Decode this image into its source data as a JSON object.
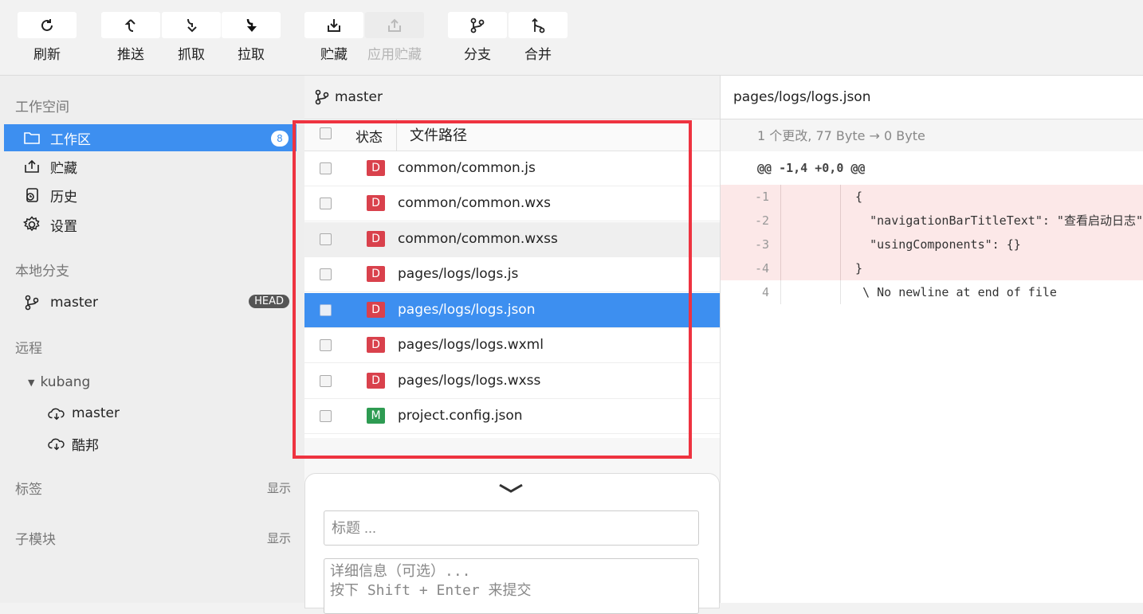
{
  "toolbar": {
    "refresh": "刷新",
    "push": "推送",
    "fetch": "抓取",
    "pull": "拉取",
    "stash": "贮藏",
    "apply_stash": "应用贮藏",
    "branch": "分支",
    "merge": "合并"
  },
  "sidebar": {
    "workspace_title": "工作空间",
    "items": [
      {
        "label": "工作区",
        "badge": "8",
        "icon": "folder-icon"
      },
      {
        "label": "贮藏",
        "icon": "stash-icon"
      },
      {
        "label": "历史",
        "icon": "history-icon"
      },
      {
        "label": "设置",
        "icon": "gear-icon"
      }
    ],
    "local_branches_title": "本地分支",
    "local_branch": {
      "label": "master",
      "badge": "HEAD"
    },
    "remote_title": "远程",
    "remote_name": "kubang",
    "remote_branches": [
      "master",
      "酷邦"
    ],
    "tags_title": "标签",
    "tags_show": "显示",
    "submodules_title": "子模块",
    "submodules_show": "显示"
  },
  "file_panel": {
    "branch": "master",
    "col_status": "状态",
    "col_path": "文件路径",
    "files": [
      {
        "status": "D",
        "path": "common/common.js"
      },
      {
        "status": "D",
        "path": "common/common.wxs"
      },
      {
        "status": "D",
        "path": "common/common.wxss"
      },
      {
        "status": "D",
        "path": "pages/logs/logs.js"
      },
      {
        "status": "D",
        "path": "pages/logs/logs.json"
      },
      {
        "status": "D",
        "path": "pages/logs/logs.wxml"
      },
      {
        "status": "D",
        "path": "pages/logs/logs.wxss"
      },
      {
        "status": "M",
        "path": "project.config.json"
      }
    ]
  },
  "commit": {
    "title_placeholder": "标题 ...",
    "desc_placeholder": "详细信息（可选）...\n按下 Shift + Enter 来提交"
  },
  "diff": {
    "file": "pages/logs/logs.json",
    "meta": "1 个更改, 77 Byte → 0 Byte",
    "hunk": "@@ -1,4 +0,0 @@",
    "lines": [
      {
        "old": "-1",
        "new": "",
        "code": "  {",
        "type": "del"
      },
      {
        "old": "-2",
        "new": "",
        "code": "    \"navigationBarTitleText\": \"查看启动日志\",",
        "type": "del"
      },
      {
        "old": "-3",
        "new": "",
        "code": "    \"usingComponents\": {}",
        "type": "del"
      },
      {
        "old": "-4",
        "new": "",
        "code": "  }",
        "type": "del"
      },
      {
        "old": "4",
        "new": "",
        "code": "   \\ No newline at end of file",
        "type": "ctx"
      }
    ]
  },
  "colors": {
    "accent": "#3d8ff0",
    "deleted": "#d9414c",
    "modified": "#2e9b52",
    "highlight": "#ee3340"
  }
}
